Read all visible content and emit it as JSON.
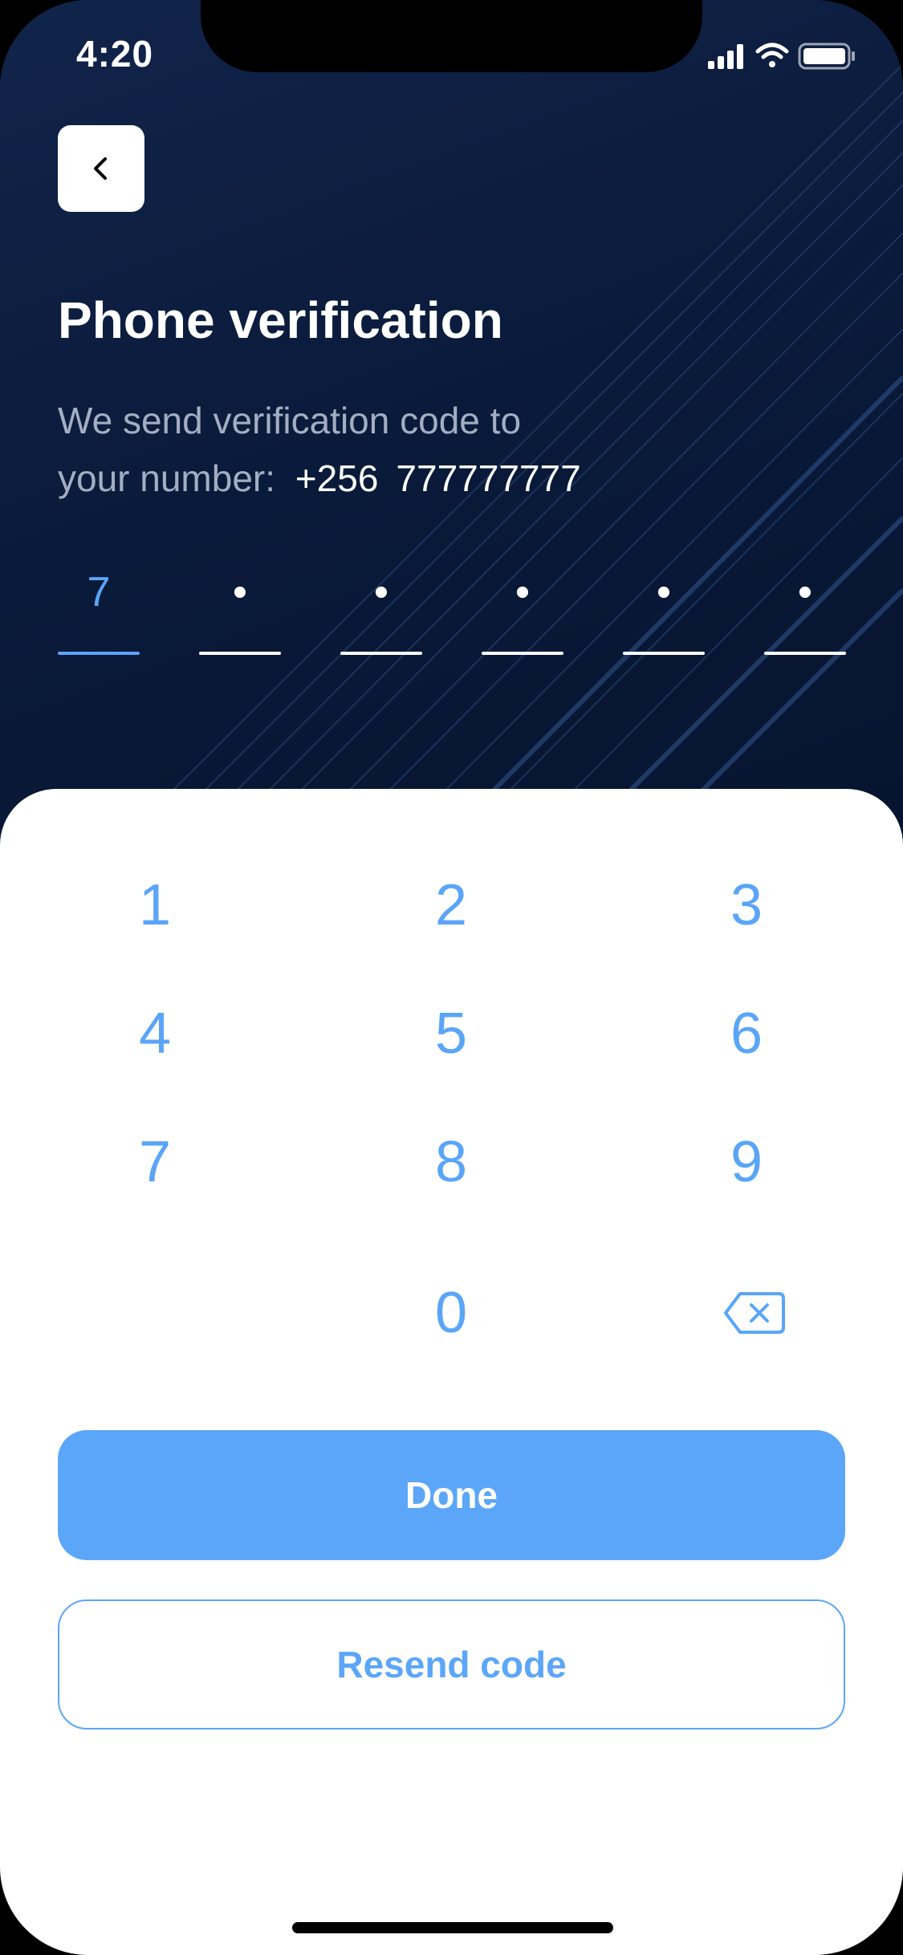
{
  "status_bar": {
    "time": "4:20",
    "icons": [
      "cellular-signal-icon",
      "wifi-icon",
      "battery-icon"
    ]
  },
  "header": {
    "back_icon": "chevron-left-icon",
    "title": "Phone verification",
    "subtitle_line1": "We send verification code to",
    "subtitle_line2": "your number:",
    "country_code": "+256",
    "phone_number": "777777777"
  },
  "otp": {
    "entered": "7",
    "placeholder": "•",
    "cells": [
      "7",
      "•",
      "•",
      "•",
      "•",
      "•"
    ],
    "active_index": 0
  },
  "keypad": {
    "keys": [
      "1",
      "2",
      "3",
      "4",
      "5",
      "6",
      "7",
      "8",
      "9",
      "0"
    ],
    "backspace_icon": "backspace-icon"
  },
  "actions": {
    "done_label": "Done",
    "resend_label": "Resend code"
  },
  "colors": {
    "accent": "#5CA6F9",
    "hero_background": "#0A1A3A",
    "sheet_background": "#FFFFFF",
    "subtitle_text": "#A3AEC2"
  }
}
